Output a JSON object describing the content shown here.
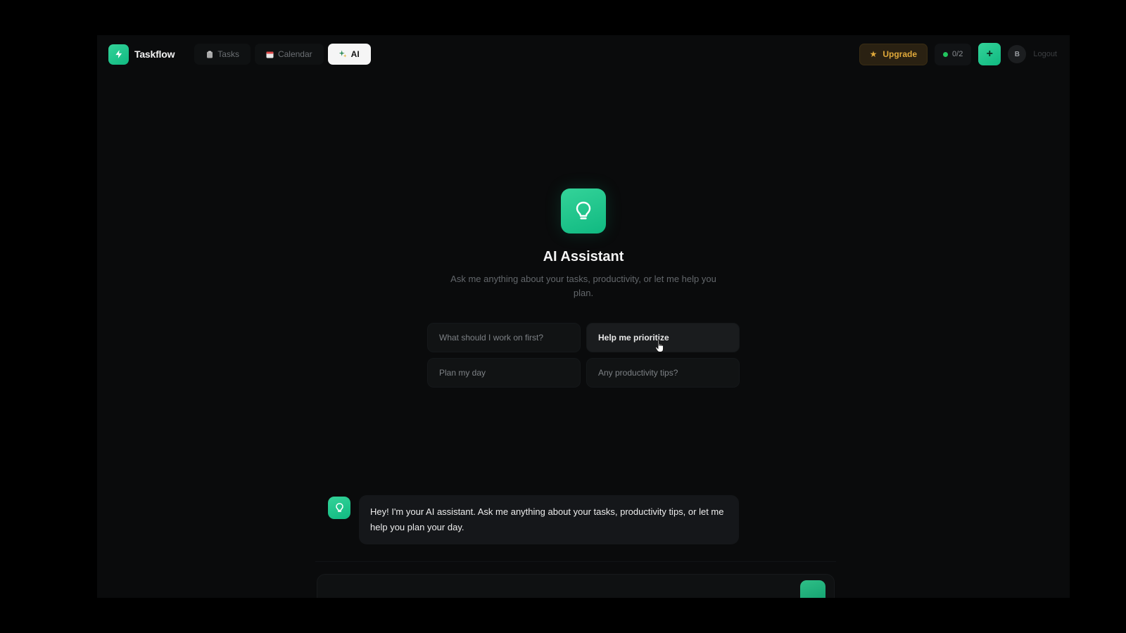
{
  "app": {
    "name": "Taskflow",
    "logo_icon": "lightning-icon",
    "accent_color": "#10b981"
  },
  "nav": {
    "tabs": [
      {
        "label": "Tasks",
        "icon": "clipboard-icon",
        "active": false
      },
      {
        "label": "Calendar",
        "icon": "calendar-icon",
        "active": false
      },
      {
        "label": "AI",
        "icon": "sparkles-icon",
        "active": true
      }
    ]
  },
  "header": {
    "upgrade_label": "Upgrade",
    "upgrade_icon": "star-icon",
    "usage_text": "0/2",
    "add_label": "+",
    "avatar_initial": "B",
    "logout_label": "Logout"
  },
  "hero": {
    "icon": "lightbulb-icon",
    "title": "AI Assistant",
    "subtitle": "Ask me anything about your tasks, productivity, or let me help you plan."
  },
  "suggestions": [
    {
      "label": "What should I work on first?"
    },
    {
      "label": "Help me prioritize"
    },
    {
      "label": "Plan my day"
    },
    {
      "label": "Any productivity tips?"
    }
  ],
  "chat": {
    "messages": [
      {
        "role": "assistant",
        "text": "Hey! I'm your AI assistant. Ask me anything about your tasks, productivity tips, or let me help you plan your day."
      }
    ]
  }
}
